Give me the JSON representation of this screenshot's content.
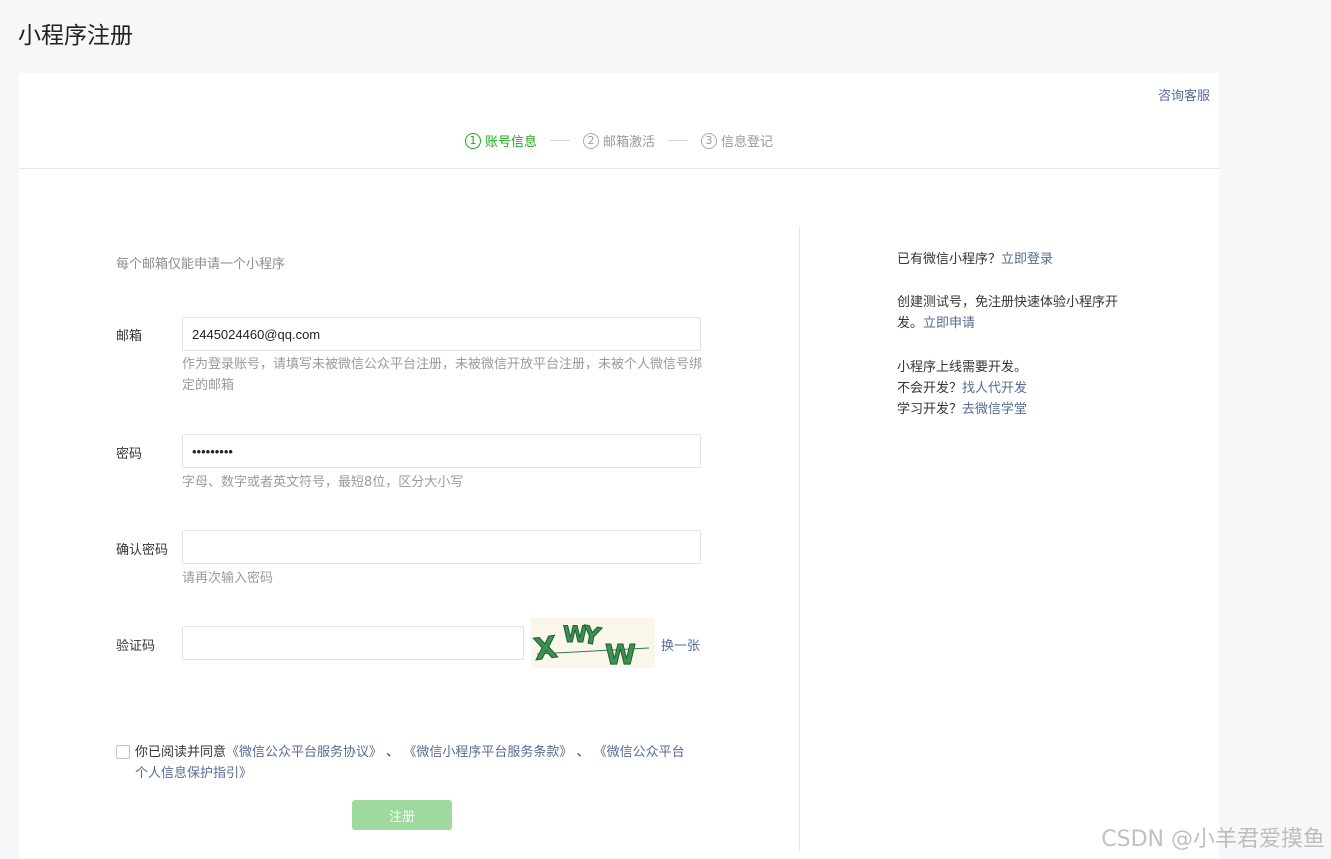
{
  "page_title": "小程序注册",
  "consult_link": "咨询客服",
  "steps": [
    {
      "num": "1",
      "label": "账号信息",
      "active": true
    },
    {
      "num": "2",
      "label": "邮箱激活",
      "active": false
    },
    {
      "num": "3",
      "label": "信息登记",
      "active": false
    }
  ],
  "form": {
    "notice": "每个邮箱仅能申请一个小程序",
    "email": {
      "label": "邮箱",
      "value": "2445024460@qq.com",
      "hint": "作为登录账号，请填写未被微信公众平台注册，未被微信开放平台注册，未被个人微信号绑定的邮箱"
    },
    "password": {
      "label": "密码",
      "value": "•••••••••",
      "hint": "字母、数字或者英文符号，最短8位，区分大小写"
    },
    "confirm_password": {
      "label": "确认密码",
      "value": "",
      "hint": "请再次输入密码"
    },
    "captcha": {
      "label": "验证码",
      "value": "",
      "image_text": "XWYW",
      "refresh_label": "换一张"
    },
    "agreement": {
      "prefix": "你已阅读并同意",
      "link1": "《微信公众平台服务协议》",
      "sep1": " 、",
      "link2": "《微信小程序平台服务条款》",
      "sep2": " 、",
      "link3": "《微信公众平台个人信息保护指引》",
      "checked": false
    },
    "submit_label": "注册"
  },
  "sidebar": {
    "login_text": "已有微信小程序？",
    "login_link": "立即登录",
    "test_text": "创建测试号，免注册快速体验小程序开发。",
    "test_link": "立即申请",
    "dev_line1": "小程序上线需要开发。",
    "dev_line2_text": "不会开发？",
    "dev_line2_link": "找人代开发",
    "dev_line3_text": "学习开发？",
    "dev_line3_link": "去微信学堂"
  },
  "watermark": "CSDN @小羊君爱摸鱼",
  "colors": {
    "accent_green": "#1aad19",
    "link_blue": "#576b95",
    "disabled_button": "#9ed99d"
  }
}
